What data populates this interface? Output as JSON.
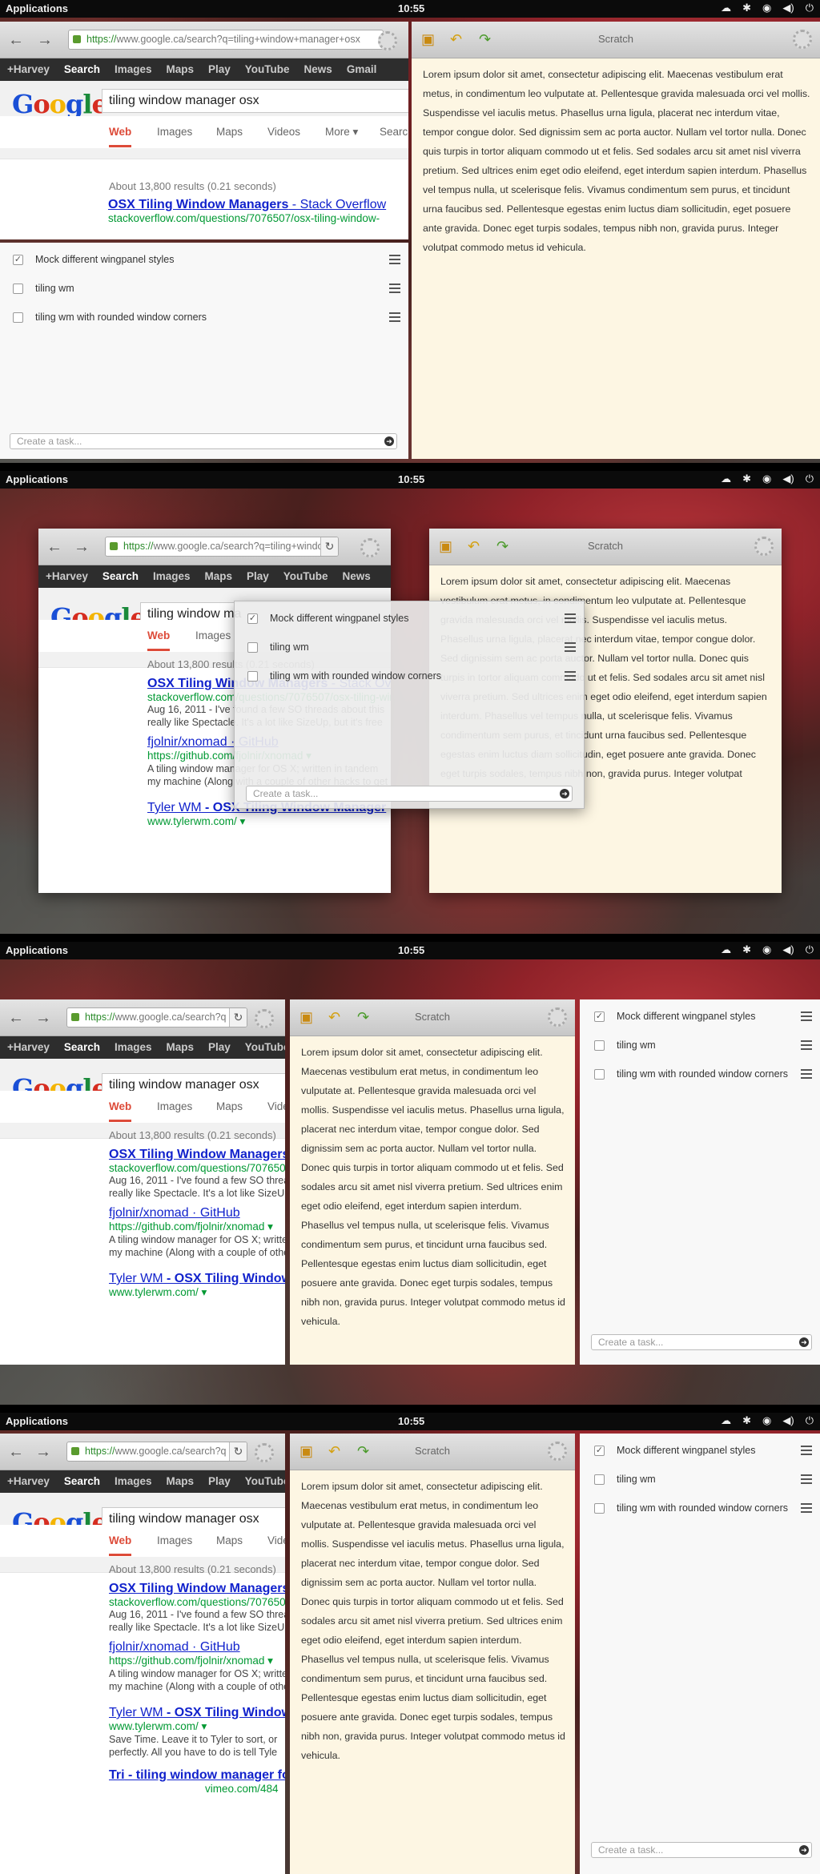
{
  "topbar": {
    "apps": "Applications",
    "clock": "10:55",
    "indicators": [
      "☁",
      "✱",
      "◉",
      "◀)",
      "⏻"
    ]
  },
  "browser": {
    "url_https": "https://",
    "url_rest": "www.google.ca/search?q=tiling+window+manager+osx",
    "url_rest_short": "www.google.ca/search?q=tiling+window",
    "url_rest_tiny": "www.google.ca/search?q",
    "gbar_items": [
      "+Harvey",
      "Search",
      "Images",
      "Maps",
      "Play",
      "YouTube",
      "News",
      "Gmail"
    ],
    "logo": [
      "G",
      "o",
      "o",
      "g",
      "l",
      "e"
    ],
    "query": "tiling window manager osx",
    "query_short": "tiling window ma",
    "tabs": [
      "Web",
      "Images",
      "Maps",
      "Videos",
      "More ▾",
      "Search"
    ],
    "stats": "About 13,800 results (0.21 seconds)",
    "stats_short": "About 13,800 results (0.21 seconds)",
    "results": [
      {
        "title_a": "OSX Tiling Window Managers",
        "title_b": " - Stack Overflow",
        "url": "stackoverflow.com/questions/7076507/osx-tiling-window-",
        "snippet": "Aug 16, 2011 - I've found a few SO threads about this",
        "snippet2": "really like Spectacle. It's a lot like SizeUp, but it's free"
      },
      {
        "title_a": "fjolnir/xnomad",
        "title_b": " · GitHub",
        "url": "https://github.com/fjolnir/xnomad ▾",
        "snippet": "A tiling window manager for OS X; written in tandem",
        "snippet2": "my machine (Along with a couple of other hacks to get"
      },
      {
        "title_a": "Tyler WM",
        "title_b": " - OSX Tiling Window Manager",
        "url": "www.tylerwm.com/ ▾",
        "snippet": "Save Time. Leave it to Tyler to sort, or",
        "snippet2": "perfectly. All you have to do is tell Tyle"
      },
      {
        "title_a": "Tri",
        "title_b": " - tiling window manager fo",
        "url": "vimeo.com/484",
        "snippet": "",
        "snippet2": ""
      }
    ]
  },
  "scratch": {
    "title": "Scratch",
    "text": "Lorem ipsum dolor sit amet, consectetur adipiscing elit. Maecenas vestibulum erat metus, in condimentum leo vulputate at. Pellentesque gravida malesuada orci vel mollis. Suspendisse vel iaculis metus. Phasellus urna ligula, placerat nec interdum vitae, tempor congue dolor. Sed dignissim sem ac porta auctor. Nullam vel tortor nulla. Donec quis turpis in tortor aliquam commodo ut et felis. Sed sodales arcu sit amet nisl viverra pretium. Sed ultrices enim eget odio eleifend, eget interdum sapien interdum. Phasellus vel tempus nulla, ut scelerisque felis. Vivamus condimentum sem purus, et tincidunt urna faucibus sed. Pellentesque egestas enim luctus diam sollicitudin, eget posuere ante gravida. Donec eget turpis sodales, tempus nibh non, gravida purus. Integer volutpat commodo metus id vehicula."
  },
  "tasks": {
    "items": [
      {
        "label": "Mock different wingpanel styles",
        "done": true
      },
      {
        "label": "tiling wm",
        "done": false
      },
      {
        "label": "tiling wm with rounded window corners",
        "done": false
      }
    ],
    "create_placeholder": "Create a task...",
    "check_mark": "✓",
    "go_arrow": "➜"
  },
  "colors": {
    "accent_red": "#dd4b39",
    "link_blue": "#1122cc",
    "url_green": "#009933",
    "note_bg": "#fdf6e3"
  }
}
